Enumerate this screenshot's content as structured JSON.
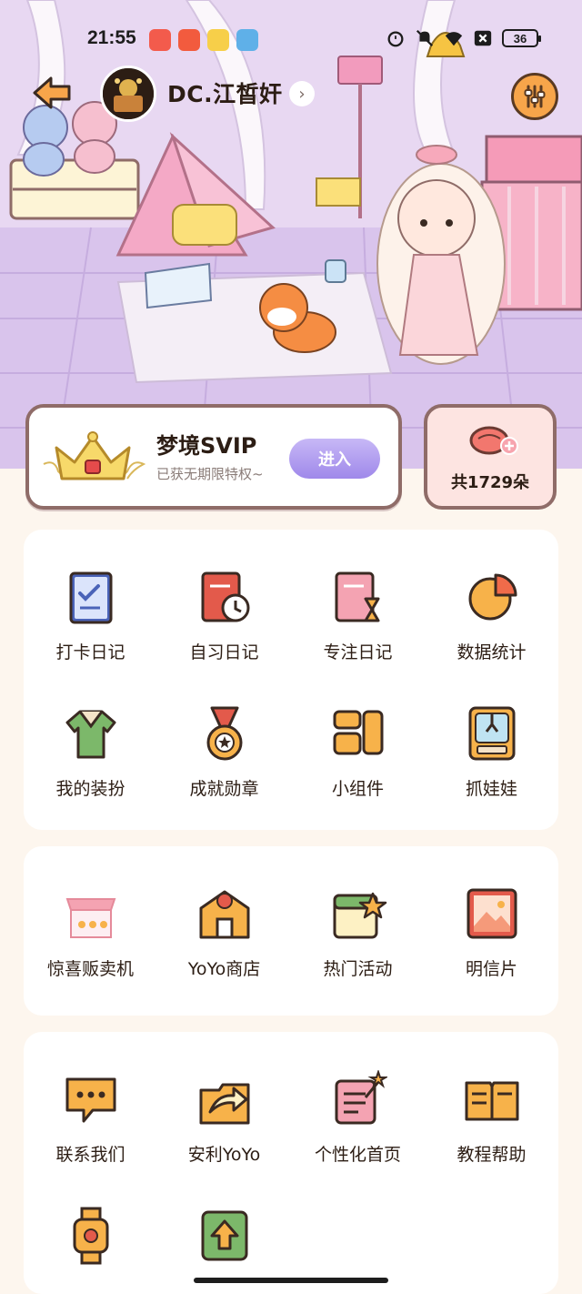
{
  "status_bar": {
    "time": "21:55",
    "battery": "36",
    "icons": [
      "alarm-icon",
      "mute-icon",
      "wifi-icon",
      "close-box-icon"
    ],
    "notification_icons": [
      "weibo-icon",
      "app-icon",
      "app-icon",
      "app-icon"
    ]
  },
  "header": {
    "user_name": "DC.江皙奸",
    "back_icon": "back-arrow-icon",
    "settings_icon": "sliders-icon"
  },
  "vip": {
    "title": "梦境SVIP",
    "subtitle": "已获无期限特权~",
    "enter_label": "进入"
  },
  "flowers": {
    "count_label": "共1729朵"
  },
  "grid1": [
    {
      "label": "打卡日记",
      "icon": "checklist-diary-icon"
    },
    {
      "label": "自习日记",
      "icon": "study-diary-icon"
    },
    {
      "label": "专注日记",
      "icon": "focus-diary-icon"
    },
    {
      "label": "数据统计",
      "icon": "pie-chart-icon"
    },
    {
      "label": "我的装扮",
      "icon": "outfit-icon"
    },
    {
      "label": "成就勋章",
      "icon": "medal-icon"
    },
    {
      "label": "小组件",
      "icon": "widget-icon"
    },
    {
      "label": "抓娃娃",
      "icon": "claw-machine-icon"
    }
  ],
  "grid2": [
    {
      "label": "惊喜贩卖机",
      "icon": "vending-machine-icon"
    },
    {
      "label": "YoYo商店",
      "icon": "shop-icon"
    },
    {
      "label": "热门活动",
      "icon": "calendar-star-icon"
    },
    {
      "label": "明信片",
      "icon": "postcard-icon"
    }
  ],
  "grid3": [
    {
      "label": "联系我们",
      "icon": "chat-bubble-icon"
    },
    {
      "label": "安利YoYo",
      "icon": "share-icon"
    },
    {
      "label": "个性化首页",
      "icon": "personalize-icon"
    },
    {
      "label": "教程帮助",
      "icon": "book-icon"
    },
    {
      "label": "",
      "icon": "watch-icon"
    },
    {
      "label": "",
      "icon": "upload-icon"
    }
  ]
}
